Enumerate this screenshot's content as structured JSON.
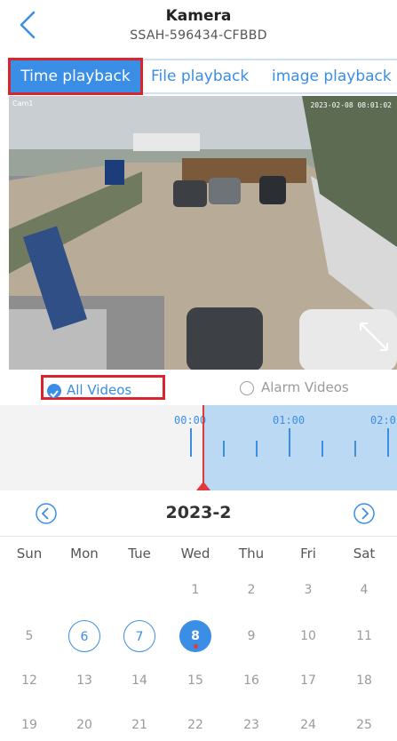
{
  "header": {
    "title": "Kamera",
    "subtitle": "SSAH-596434-CFBBD"
  },
  "tabs": [
    {
      "label": "Time playback",
      "active": true
    },
    {
      "label": "File playback",
      "active": false
    },
    {
      "label": "image playback",
      "active": false
    }
  ],
  "video": {
    "timestamp": "2023-02-08 08:01:02",
    "camera_label": "Cam1"
  },
  "filters": {
    "all_label": "All Videos",
    "alarm_label": "Alarm Videos",
    "selected": "all"
  },
  "timeline": {
    "labels": [
      "00:00",
      "01:00",
      "02:0"
    ]
  },
  "calendar": {
    "month_title": "2023-2",
    "weekdays": [
      "Sun",
      "Mon",
      "Tue",
      "Wed",
      "Thu",
      "Fri",
      "Sat"
    ],
    "weeks": [
      [
        "",
        "",
        "",
        "1",
        "2",
        "3",
        "4"
      ],
      [
        "5",
        "6",
        "7",
        "8",
        "9",
        "10",
        "11"
      ],
      [
        "12",
        "13",
        "14",
        "15",
        "16",
        "17",
        "18"
      ],
      [
        "19",
        "20",
        "21",
        "22",
        "23",
        "24",
        "25"
      ]
    ],
    "has_video_days": [
      "6",
      "7",
      "8"
    ],
    "selected_day": "8"
  },
  "colors": {
    "accent": "#3a8ee6",
    "highlight": "#d9242b",
    "cursor": "#e23a3a"
  }
}
